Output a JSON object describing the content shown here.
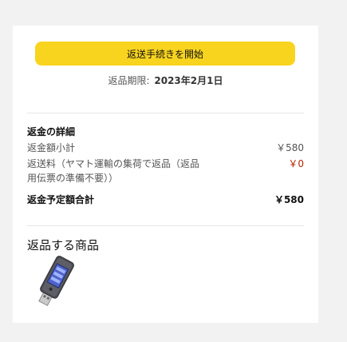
{
  "actions": {
    "start_return_label": "返送手続きを開始"
  },
  "deadline": {
    "label": "返品期限:",
    "date": "2023年2月1日"
  },
  "details": {
    "title": "返金の詳細",
    "subtotal_label": "返金額小計",
    "subtotal_value": "￥580",
    "shipping_label_line1": "返送料（ヤマト運輸の集荷で返品（返品",
    "shipping_label_line2": "用伝票の準備不要））",
    "shipping_value": "￥0",
    "total_label": "返金予定額合計",
    "total_value": "￥580"
  },
  "items": {
    "title": "返品する商品",
    "product_icon": "usb-tester-icon"
  },
  "colors": {
    "button": "#f8d41f",
    "price_red": "#b12704"
  }
}
